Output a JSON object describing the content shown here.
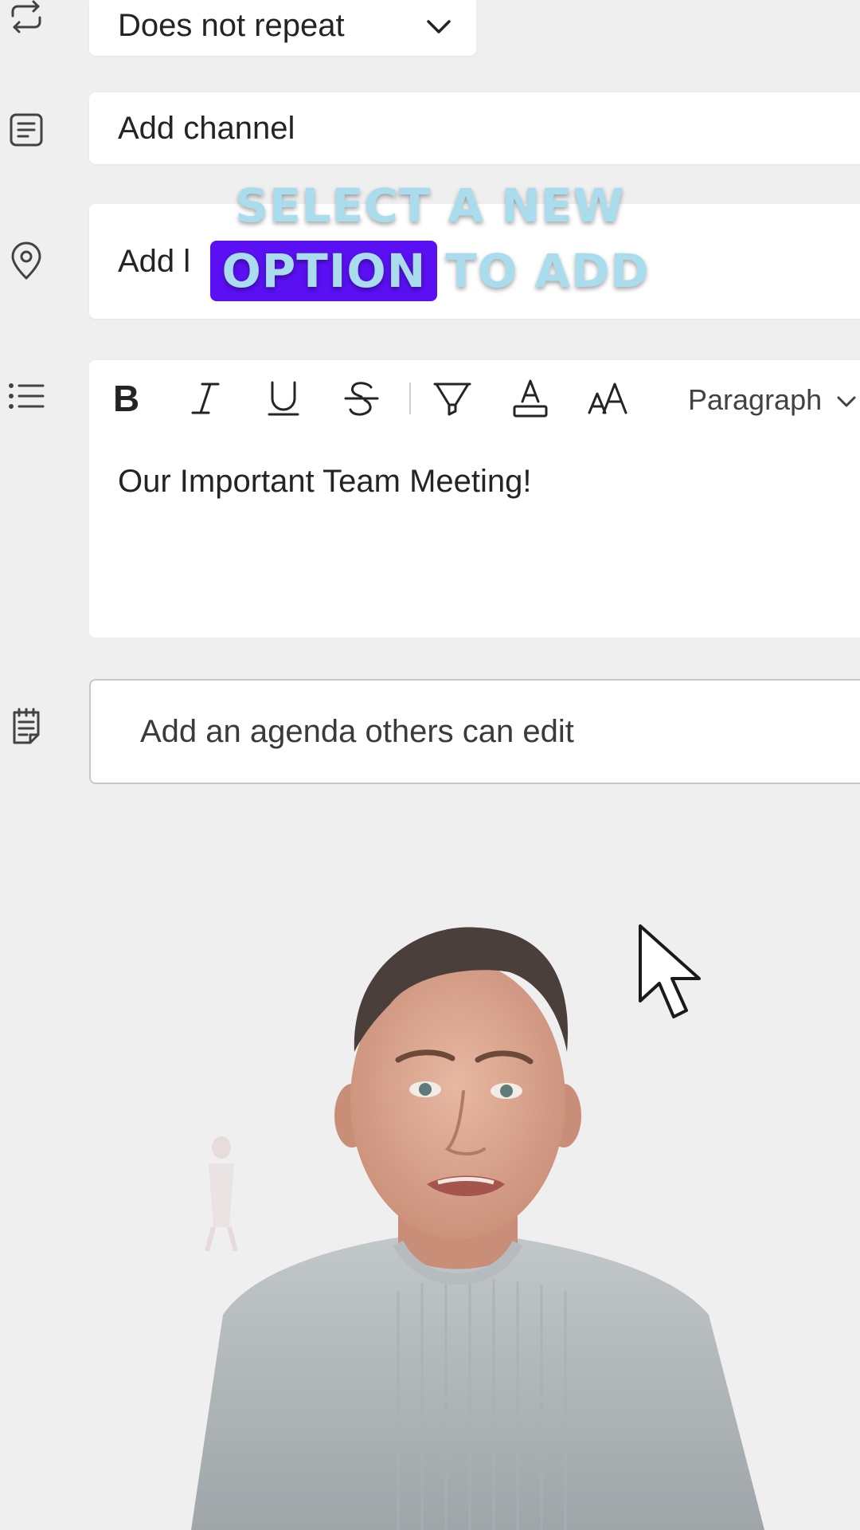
{
  "repeat": {
    "value": "Does not repeat",
    "icon": "repeat-icon",
    "chevron_icon": "chevron-down-icon"
  },
  "channel": {
    "placeholder": "Add channel",
    "icon": "channel-icon"
  },
  "location": {
    "placeholder_visible": "Add l",
    "icon": "location-pin-icon"
  },
  "details": {
    "icon": "bulleted-list-icon",
    "toolbar": {
      "bold_icon": "bold-icon",
      "italic_icon": "italic-icon",
      "underline_icon": "underline-icon",
      "strikethrough_icon": "strikethrough-icon",
      "highlight_icon": "highlight-icon",
      "font_color_icon": "font-color-icon",
      "font_size_icon": "font-size-icon",
      "paragraph_label": "Paragraph"
    },
    "body_text": "Our Important Team Meeting!"
  },
  "agenda": {
    "placeholder": "Add an agenda others can edit",
    "icon": "notes-icon"
  },
  "caption": {
    "line1": "SELECT A NEW",
    "line2_highlight": "OPTION",
    "line2_rest": "TO ADD",
    "highlight_color": "#5a10f2",
    "text_color": "#a9dcec"
  }
}
